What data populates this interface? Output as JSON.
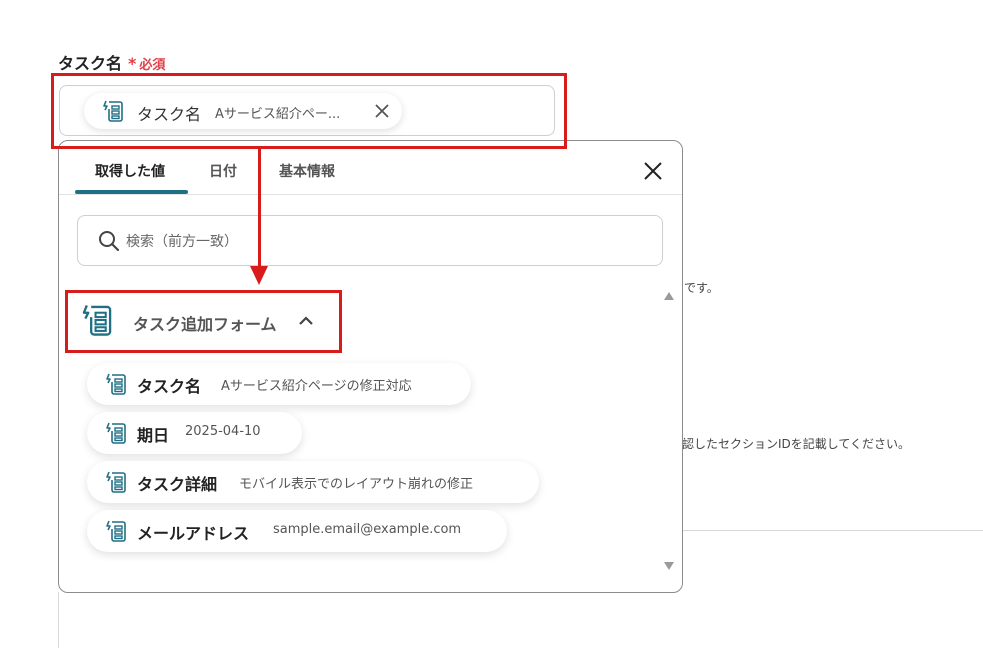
{
  "field": {
    "label": "タスク名",
    "required_mark": "*",
    "required_text": "必須",
    "token": {
      "icon": "form-icon",
      "name": "タスク名",
      "value": "Aサービス紹介ペー..."
    }
  },
  "background": {
    "text1": "です。",
    "text2": "認したセクションIDを記載してください。"
  },
  "panel": {
    "tabs": [
      {
        "label": "取得した値",
        "active": true
      },
      {
        "label": "日付",
        "active": false
      },
      {
        "label": "基本情報",
        "active": false
      }
    ],
    "search": {
      "placeholder": "検索（前方一致）",
      "value": ""
    },
    "group": {
      "label": "タスク追加フォーム",
      "icon": "form-trigger-icon",
      "expanded": true
    },
    "items": [
      {
        "name": "タスク名",
        "value": "Aサービス紹介ページの修正対応"
      },
      {
        "name": "期日",
        "value": "2025-04-10"
      },
      {
        "name": "タスク詳細",
        "value": "モバイル表示でのレイアウト崩れの修正"
      },
      {
        "name": "メールアドレス",
        "value": "sample.email@example.com"
      }
    ]
  },
  "colors": {
    "accent": "#1f6f85",
    "required": "#e0404a",
    "annotation": "#d81c1c"
  }
}
